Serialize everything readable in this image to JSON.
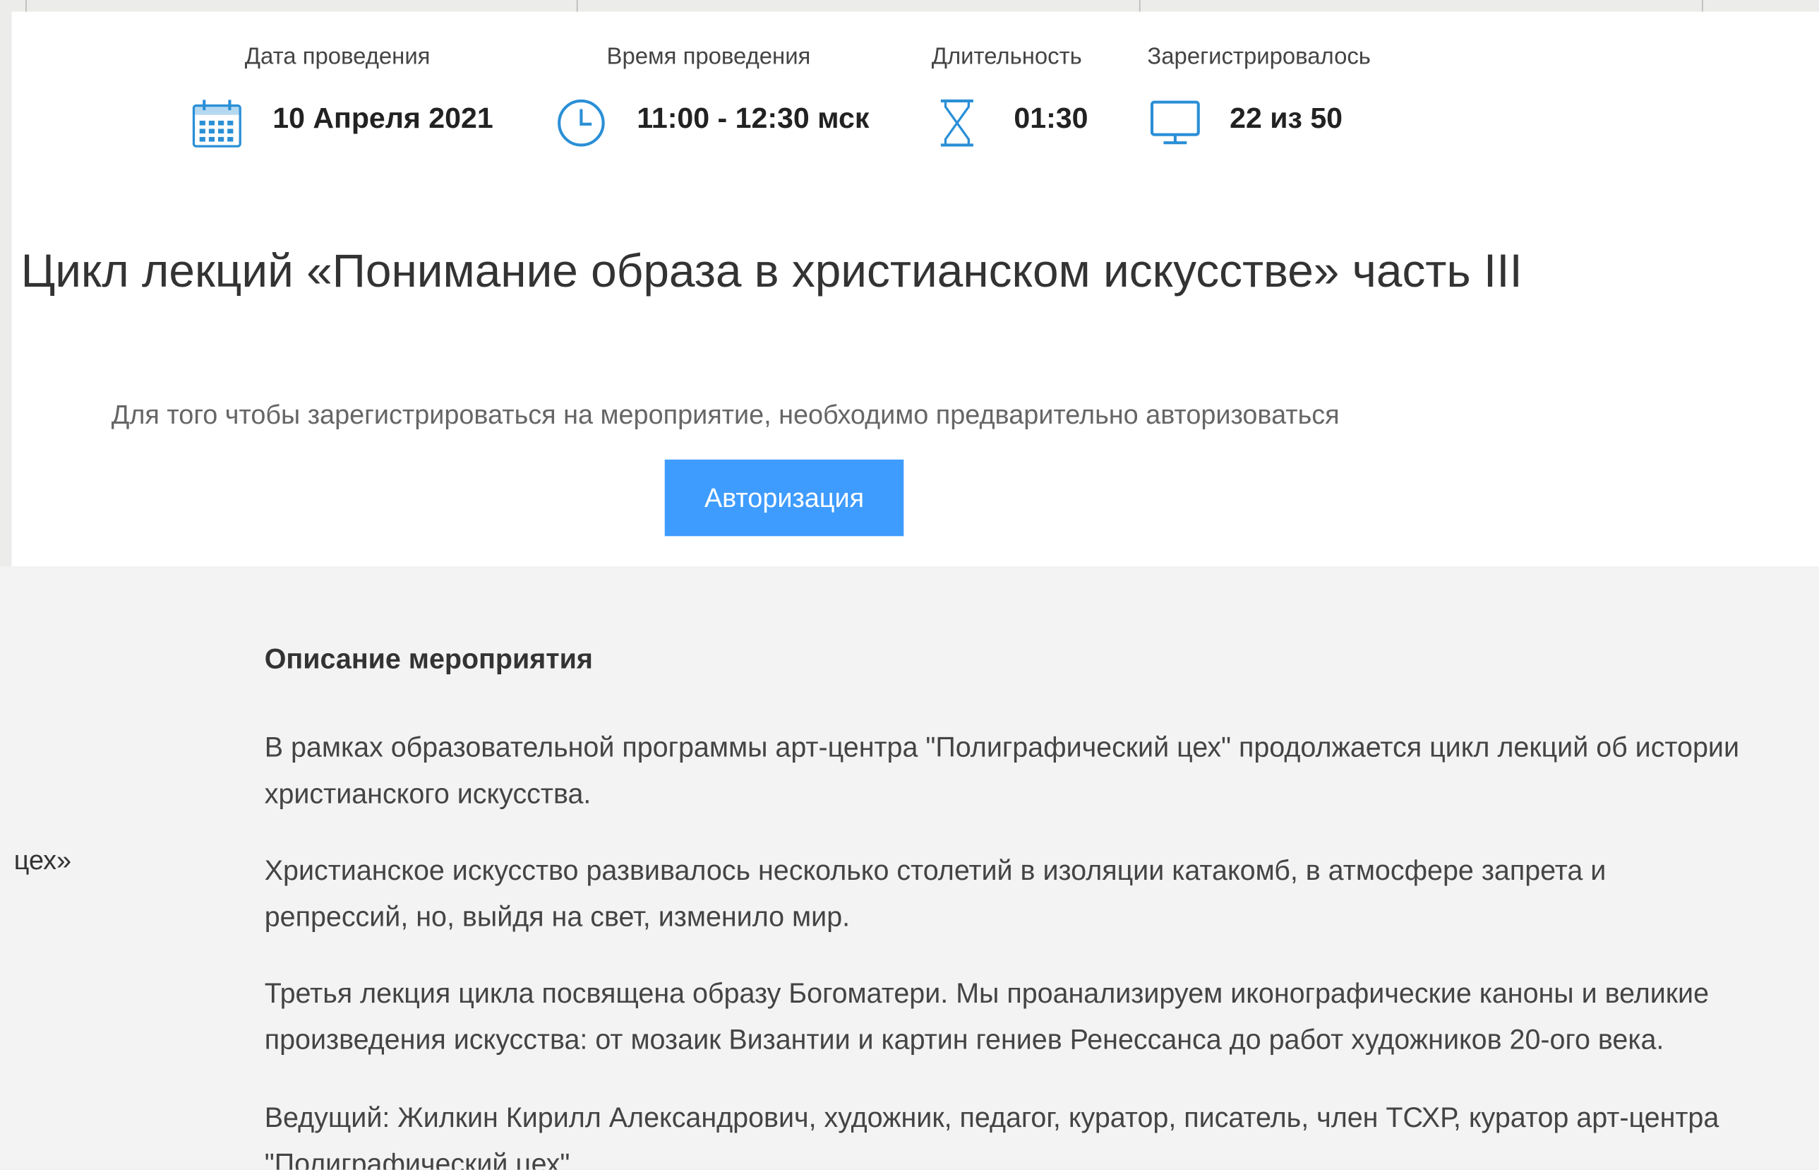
{
  "event_info": {
    "date_label": "Дата проведения",
    "date_value": "10 Апреля 2021",
    "time_label": "Время проведения",
    "time_value": "11:00 - 12:30 мск",
    "duration_label": "Длительность",
    "duration_value": "01:30",
    "registered_label": "Зарегистрировалось",
    "registered_value": "22 из 50",
    "icons": [
      "calendar-icon",
      "clock-icon",
      "hourglass-icon",
      "monitor-icon"
    ],
    "icon_color": "#2a8fd6"
  },
  "title": "Цикл лекций «Понимание образа в христианском искусстве» часть III",
  "auth": {
    "notice": "Для того чтобы зарегистрироваться на мероприятие, необходимо предварительно авторизоваться",
    "button_label": "Авторизация",
    "button_color": "#3f9cff"
  },
  "side_fragment": "цех»",
  "description": {
    "heading": "Описание мероприятия",
    "paragraphs": [
      [
        "В рамках образовательной программы арт-центра \"Полиграфический цех\" продолжается цикл лекций об истории",
        "христианского искусства."
      ],
      [
        "Христианское искусство развивалось несколько столетий в изоляции катакомб, в атмосфере запрета и",
        "репрессий, но, выйдя на свет, изменило мир."
      ],
      [
        "Третья лекция цикла посвящена образу Богоматери. Мы проанализируем иконографические каноны и великие",
        "произведения искусства: от мозаик Византии и картин гениев Ренессанса до работ художников 20-ого века."
      ],
      [
        "Ведущий: Жилкин Кирилл Александрович, художник, педагог, куратор, писатель, член ТСХР, куратор арт-центра",
        "\"Полиграфический цех\""
      ]
    ]
  }
}
